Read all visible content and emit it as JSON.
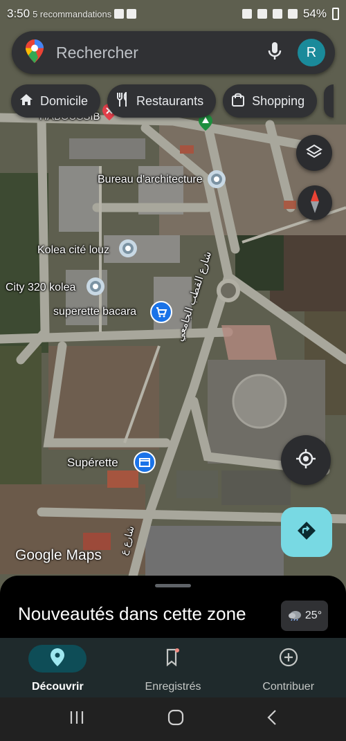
{
  "status_bar": {
    "time": "3:50",
    "left_text": "5 recommandations",
    "battery": "54%"
  },
  "search": {
    "placeholder": "Rechercher",
    "avatar_letter": "R"
  },
  "chips": [
    {
      "label": "Domicile",
      "icon": "home-icon"
    },
    {
      "label": "Restaurants",
      "icon": "restaurant-icon"
    },
    {
      "label": "Shopping",
      "icon": "shopping-bag-icon"
    }
  ],
  "map_labels": {
    "habou": "HABOUSSIB",
    "bureau": "Bureau d'architecture",
    "kolea": "Kolea cité louz",
    "city320": "City 320 kolea",
    "bacara": "superette bacara",
    "superette": "Supérette",
    "street1": "شارع القطب الجامعي",
    "street2": "شارع ع"
  },
  "google_logo": "Google Maps",
  "sheet": {
    "title": "Nouveautés dans cette zone",
    "temperature": "25°"
  },
  "nav": [
    {
      "label": "Découvrir",
      "icon": "explore-pin-icon",
      "active": true
    },
    {
      "label": "Enregistrés",
      "icon": "bookmark-icon",
      "active": false
    },
    {
      "label": "Contribuer",
      "icon": "add-circle-icon",
      "active": false
    }
  ],
  "colors": {
    "accent": "#78d9e3",
    "surface": "#303134",
    "nav_bg": "#1f2a2c",
    "active_pill": "#0e4d57"
  }
}
